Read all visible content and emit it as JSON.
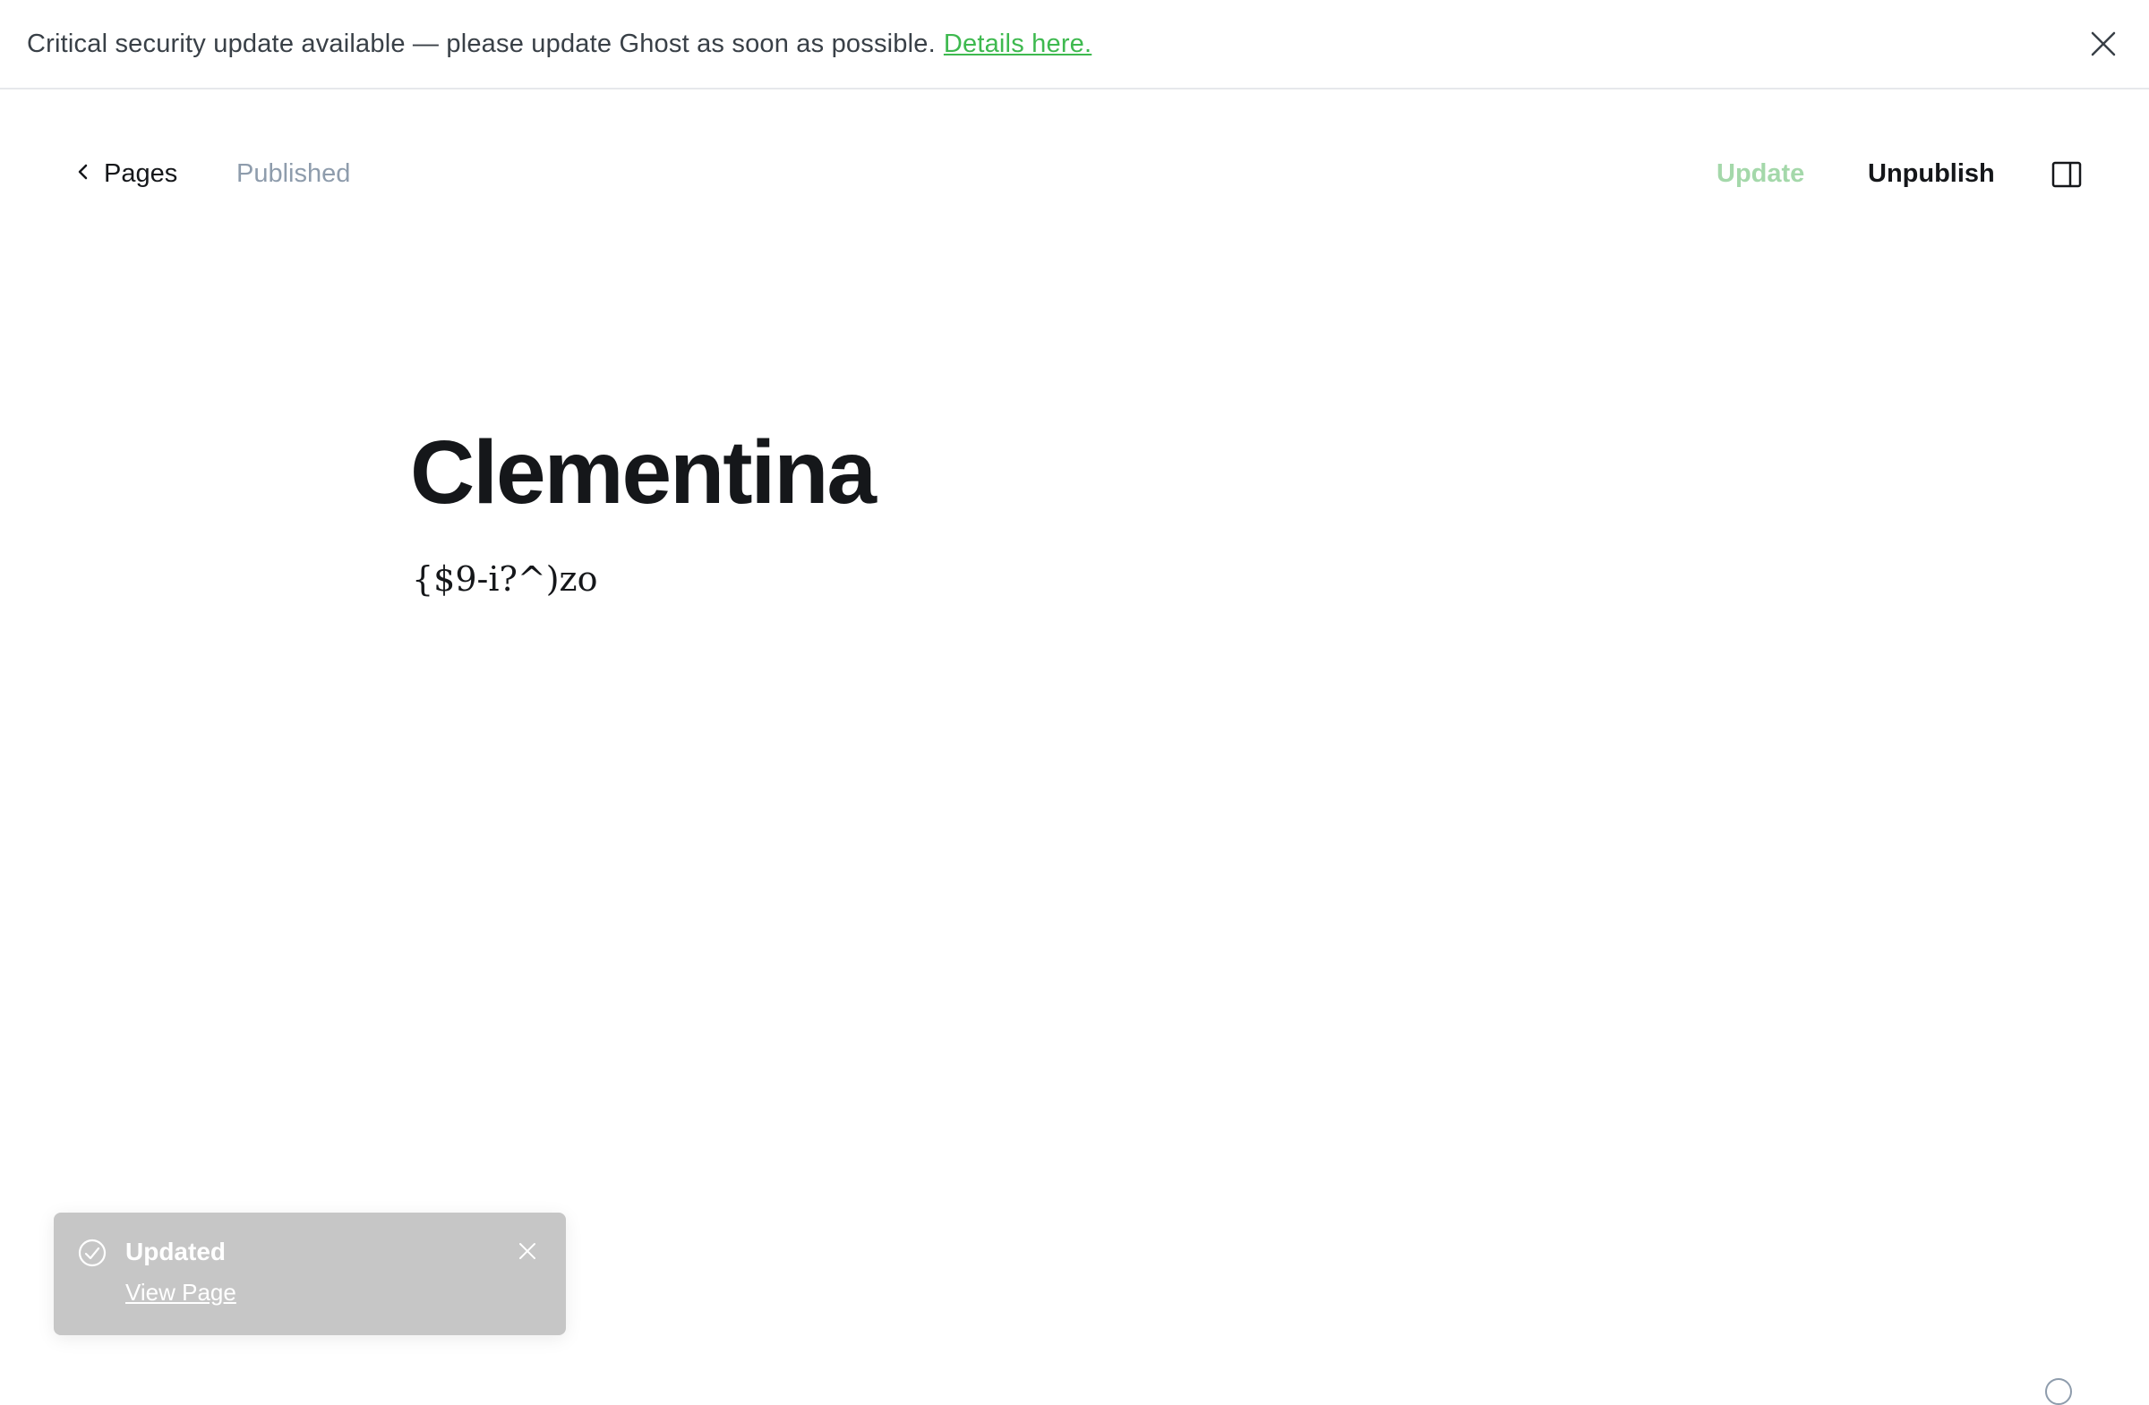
{
  "banner": {
    "message": "Critical security update available — please update Ghost as soon as possible.",
    "link_label": "Details here."
  },
  "header": {
    "back_label": "Pages",
    "status": "Published",
    "update_label": "Update",
    "unpublish_label": "Unpublish"
  },
  "editor": {
    "title": "Clementina",
    "body": "{$9-i?^)zo"
  },
  "toast": {
    "title": "Updated",
    "link_label": "View Page"
  },
  "colors": {
    "accent": "#3eb94f",
    "update_disabled": "#a4d8aa",
    "muted": "#8e9cac",
    "toast_bg": "#c6c6c6"
  },
  "icons": {
    "banner_close": "close-icon",
    "back": "chevron-left-icon",
    "sidebar": "sidebar-toggle-icon",
    "toast_status": "check-circle-icon",
    "toast_close": "close-icon",
    "help": "help-icon"
  }
}
